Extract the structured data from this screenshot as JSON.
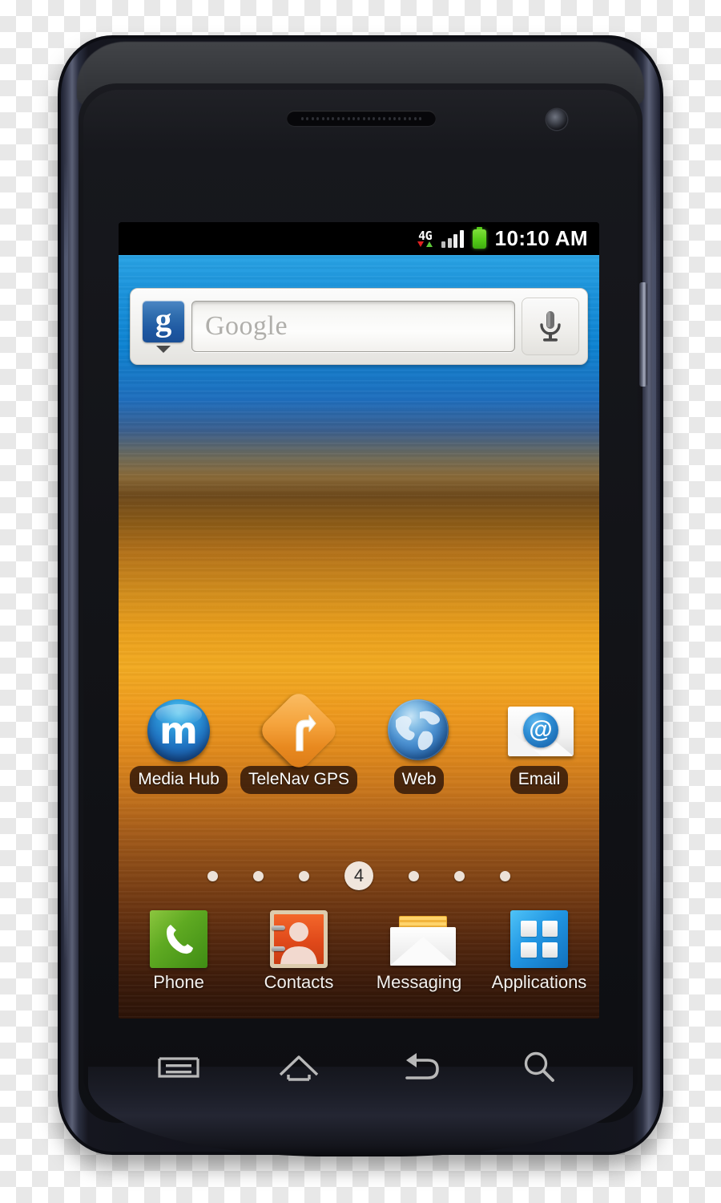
{
  "device": {
    "type": "smartphone",
    "body_color": "#12131a",
    "rim_color": "#5b6076"
  },
  "status_bar": {
    "network_label": "4G",
    "network_arrow_down_color": "#e02020",
    "network_arrow_up_color": "#5ec73a",
    "signal_bars": 4,
    "battery_color": "#55cc18",
    "clock": "10:10 AM"
  },
  "search_widget": {
    "logo_letter": "g",
    "logo_color": "#2f6dae",
    "placeholder": "Google",
    "voice_icon": "microphone-icon",
    "dropdown_icon": "chevron-down-icon"
  },
  "home_apps": [
    {
      "label": "Media Hub",
      "icon": "media-hub-icon",
      "glyph": "m",
      "color": "#2f9ede"
    },
    {
      "label": "TeleNav GPS",
      "icon": "telenav-gps-icon",
      "glyph": "turn-arrow",
      "color": "#f5a43d"
    },
    {
      "label": "Web",
      "icon": "web-browser-globe-icon",
      "glyph": "globe",
      "color": "#4e93d2"
    },
    {
      "label": "Email",
      "icon": "email-envelope-icon",
      "glyph": "@",
      "color": "#2e8fd6"
    }
  ],
  "page_indicator": {
    "total": 7,
    "active_index": 4,
    "active_label": "4"
  },
  "dock_apps": [
    {
      "label": "Phone",
      "icon": "phone-handset-icon",
      "color": "#5faa22"
    },
    {
      "label": "Contacts",
      "icon": "contacts-person-icon",
      "color": "#e0491a"
    },
    {
      "label": "Messaging",
      "icon": "messaging-envelope-icon",
      "color": "#f2b53c"
    },
    {
      "label": "Applications",
      "icon": "applications-grid-icon",
      "color": "#2196e3"
    }
  ],
  "nav_buttons": [
    {
      "name": "menu",
      "icon": "menu-icon"
    },
    {
      "name": "home",
      "icon": "home-icon"
    },
    {
      "name": "back",
      "icon": "back-arrow-icon"
    },
    {
      "name": "search",
      "icon": "search-magnifier-icon"
    }
  ],
  "wallpaper": {
    "top_color": "#0d83d2",
    "mid_color": "#f2ab22",
    "bottom_color": "#2b1207"
  }
}
